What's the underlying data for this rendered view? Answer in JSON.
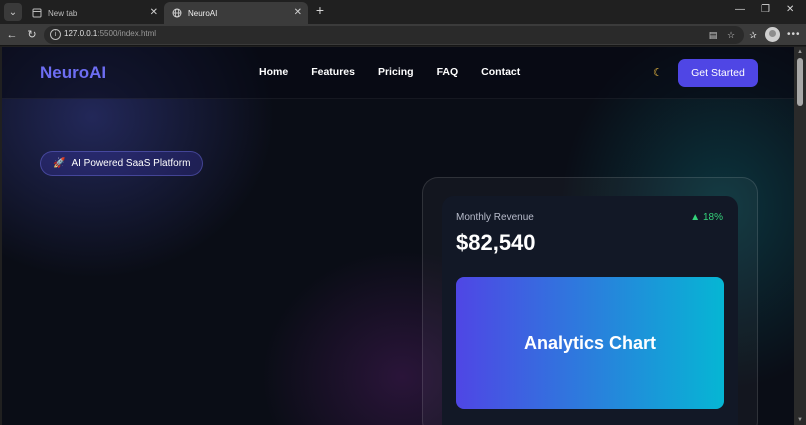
{
  "browser": {
    "tabs": [
      {
        "label": "New tab",
        "active": false
      },
      {
        "label": "NeuroAI",
        "active": true
      }
    ],
    "url_host": "127.0.0.1",
    "url_rest": ":5500/index.html",
    "icons": [
      "tab-list-icon",
      "close-icon",
      "new-tab-icon",
      "minimize-icon",
      "maximize-icon",
      "window-close-icon",
      "back-icon",
      "reload-icon",
      "site-info-icon",
      "reader-icon",
      "favorite-icon",
      "favorites-icon",
      "profile-icon",
      "more-icon"
    ]
  },
  "site": {
    "logo": "NeuroAI",
    "nav": [
      "Home",
      "Features",
      "Pricing",
      "FAQ",
      "Contact"
    ],
    "theme_icon": "moon-icon",
    "cta": "Get Started",
    "colors": {
      "brand": "#4f46e5",
      "logo": "#6d6df2",
      "positive": "#34d27a",
      "gradient_end": "#06b6d4"
    }
  },
  "hero": {
    "badge_icon": "rocket-icon",
    "badge": "AI Powered SaaS Platform"
  },
  "card": {
    "label": "Monthly Revenue",
    "change": "▲ 18%",
    "value": "$82,540",
    "chart_placeholder": "Analytics Chart"
  }
}
